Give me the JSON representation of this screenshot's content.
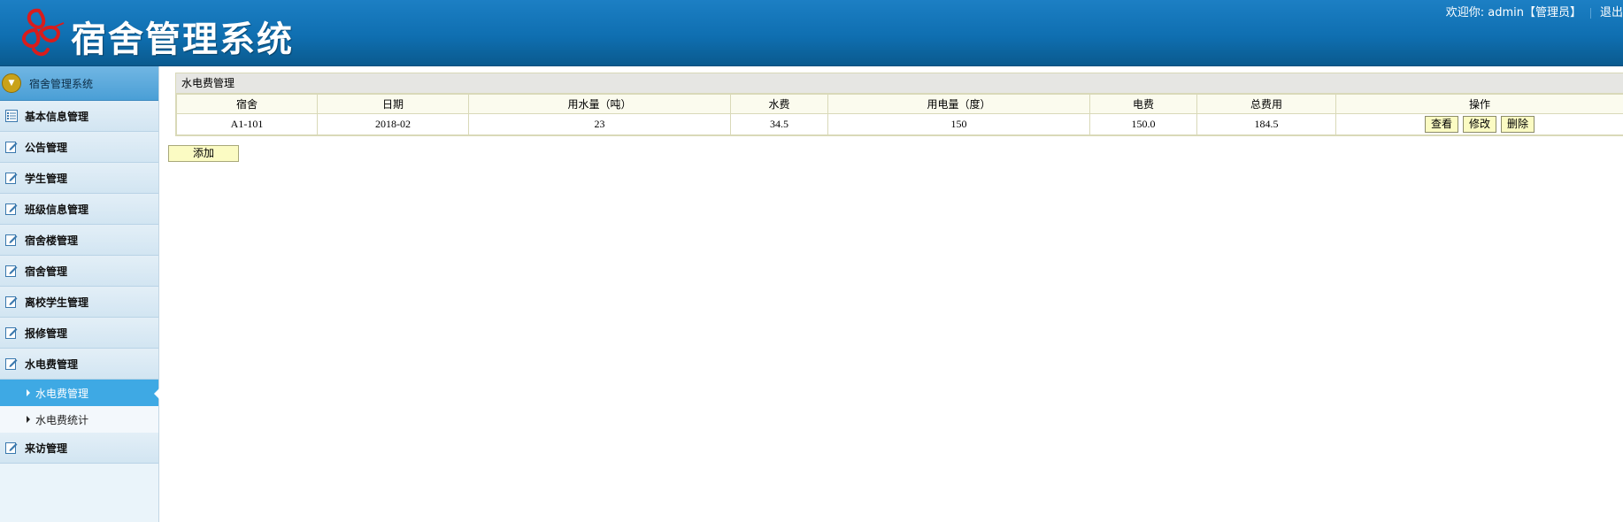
{
  "header": {
    "title": "宿舍管理系统",
    "welcome": "欢迎你: admin【管理员】",
    "logout": "退出"
  },
  "sidebar": {
    "title": "宿舍管理系统",
    "items": [
      {
        "label": "基本信息管理",
        "icon": "list-icon"
      },
      {
        "label": "公告管理",
        "icon": "edit-icon"
      },
      {
        "label": "学生管理",
        "icon": "edit-icon"
      },
      {
        "label": "班级信息管理",
        "icon": "edit-icon"
      },
      {
        "label": "宿舍楼管理",
        "icon": "edit-icon"
      },
      {
        "label": "宿舍管理",
        "icon": "edit-icon"
      },
      {
        "label": "离校学生管理",
        "icon": "edit-icon"
      },
      {
        "label": "报修管理",
        "icon": "edit-icon"
      },
      {
        "label": "水电费管理",
        "icon": "edit-icon"
      }
    ],
    "subitems": [
      {
        "label": "水电费管理",
        "active": true
      },
      {
        "label": "水电费统计",
        "active": false
      }
    ],
    "last_item": {
      "label": "来访管理",
      "icon": "edit-icon"
    }
  },
  "main": {
    "panel_title": "水电费管理",
    "columns": [
      "宿舍",
      "日期",
      "用水量（吨）",
      "水费",
      "用电量（度）",
      "电费",
      "总费用",
      "操作"
    ],
    "rows": [
      [
        "A1-101",
        "2018-02",
        "23",
        "34.5",
        "150",
        "150.0",
        "184.5"
      ]
    ],
    "actions": {
      "view": "查看",
      "edit": "修改",
      "delete": "删除"
    },
    "add_label": "添加"
  },
  "colors": {
    "header_blue": "#0f6fb1",
    "active_blue": "#3ea9e4",
    "button_yellow": "#fbfbc3"
  }
}
